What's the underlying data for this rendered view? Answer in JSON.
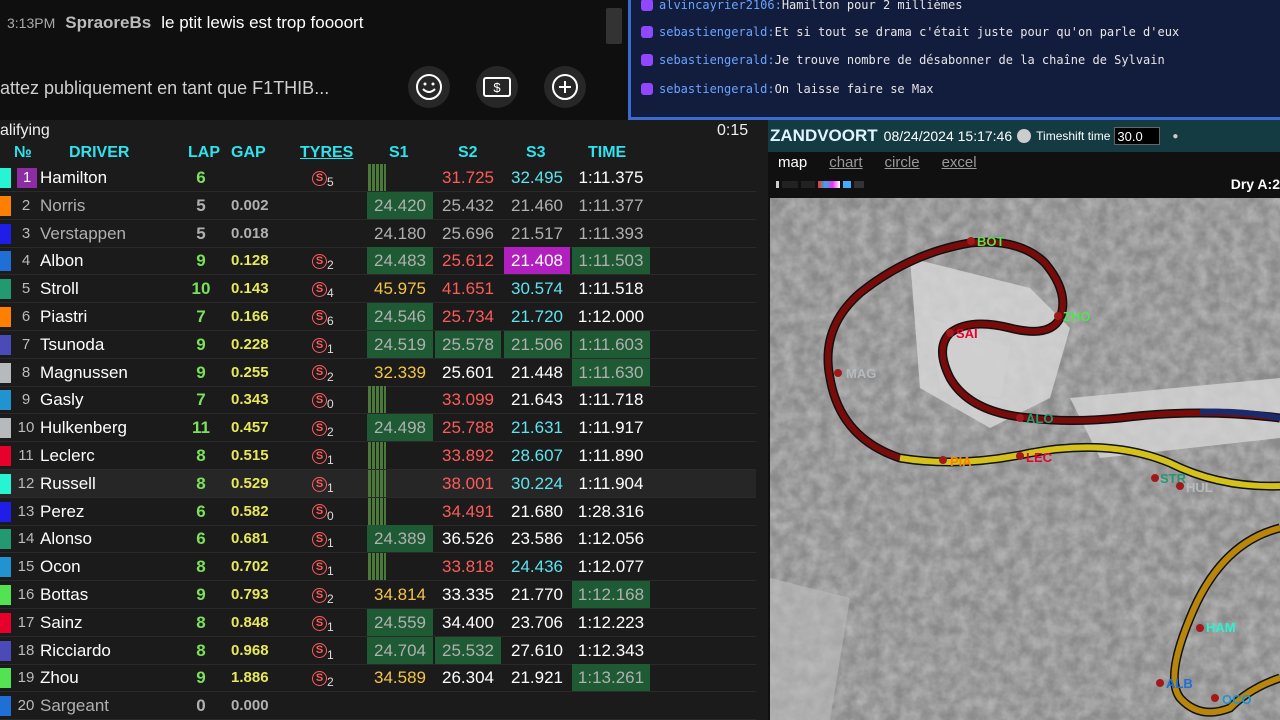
{
  "yt_chat": {
    "time": "3:13PM",
    "user": "SpraoreBs",
    "message": "le ptit lewis est trop foooort",
    "input_placeholder": "attez publiquement en tant que F1THIB..."
  },
  "twitch_chat": {
    "lines": [
      {
        "user": "alvincayrier2106:",
        "message": "Hamilton pour 2 millièmes"
      },
      {
        "user": "sebastiengerald:",
        "message": "Et si tout se drama c'était juste pour qu'on parle d'eux"
      },
      {
        "user": "sebastiengerald:",
        "message": "Je trouve nombre de désabonner de la chaîne de Sylvain"
      },
      {
        "user": "sebastiengerald:",
        "message": "On laisse faire se Max"
      }
    ]
  },
  "timing": {
    "session": "alifying",
    "clock": "0:15",
    "headers": {
      "pos": "№",
      "driver": "DRIVER",
      "lap": "LAP",
      "gap": "GAP",
      "tyres": "TYRES",
      "s1": "S1",
      "s2": "S2",
      "s3": "S3",
      "time": "TIME"
    },
    "rows": [
      {
        "pos": "1",
        "driver": "Hamilton",
        "lap": "6",
        "gap": "",
        "tyre": "S",
        "tyre_age": "5",
        "s1": "",
        "s2": "31.725",
        "s3": "32.495",
        "time": "1:11.375",
        "team_color": "#27f4d2"
      },
      {
        "pos": "2",
        "driver": "Norris",
        "lap": "5",
        "gap": "0.002",
        "tyre": "",
        "tyre_age": "",
        "s1": "24.420",
        "s2": "25.432",
        "s3": "21.460",
        "time": "1:11.377",
        "team_color": "#ff8000"
      },
      {
        "pos": "3",
        "driver": "Verstappen",
        "lap": "5",
        "gap": "0.018",
        "tyre": "",
        "tyre_age": "",
        "s1": "24.180",
        "s2": "25.696",
        "s3": "21.517",
        "time": "1:11.393",
        "team_color": "#1e1ee8"
      },
      {
        "pos": "4",
        "driver": "Albon",
        "lap": "9",
        "gap": "0.128",
        "tyre": "S",
        "tyre_age": "2",
        "s1": "24.483",
        "s2": "25.612",
        "s3": "21.408",
        "time": "1:11.503",
        "team_color": "#1e6fd6"
      },
      {
        "pos": "5",
        "driver": "Stroll",
        "lap": "10",
        "gap": "0.143",
        "tyre": "S",
        "tyre_age": "4",
        "s1": "45.975",
        "s2": "41.651",
        "s3": "30.574",
        "time": "1:11.518",
        "team_color": "#229971"
      },
      {
        "pos": "6",
        "driver": "Piastri",
        "lap": "7",
        "gap": "0.166",
        "tyre": "S",
        "tyre_age": "6",
        "s1": "24.546",
        "s2": "25.734",
        "s3": "21.720",
        "time": "1:12.000",
        "team_color": "#ff8000"
      },
      {
        "pos": "7",
        "driver": "Tsunoda",
        "lap": "9",
        "gap": "0.228",
        "tyre": "S",
        "tyre_age": "1",
        "s1": "24.519",
        "s2": "25.578",
        "s3": "21.506",
        "time": "1:11.603",
        "team_color": "#4a4ab8"
      },
      {
        "pos": "8",
        "driver": "Magnussen",
        "lap": "9",
        "gap": "0.255",
        "tyre": "S",
        "tyre_age": "2",
        "s1": "32.339",
        "s2": "25.601",
        "s3": "21.448",
        "time": "1:11.630",
        "team_color": "#b6babd"
      },
      {
        "pos": "9",
        "driver": "Gasly",
        "lap": "7",
        "gap": "0.343",
        "tyre": "S",
        "tyre_age": "0",
        "s1": "",
        "s2": "33.099",
        "s3": "21.643",
        "time": "1:11.718",
        "team_color": "#2293d1"
      },
      {
        "pos": "10",
        "driver": "Hulkenberg",
        "lap": "11",
        "gap": "0.457",
        "tyre": "S",
        "tyre_age": "2",
        "s1": "24.498",
        "s2": "25.788",
        "s3": "21.631",
        "time": "1:11.917",
        "team_color": "#b6babd"
      },
      {
        "pos": "11",
        "driver": "Leclerc",
        "lap": "8",
        "gap": "0.515",
        "tyre": "S",
        "tyre_age": "1",
        "s1": "",
        "s2": "33.892",
        "s3": "28.607",
        "time": "1:11.890",
        "team_color": "#e8002d"
      },
      {
        "pos": "12",
        "driver": "Russell",
        "lap": "8",
        "gap": "0.529",
        "tyre": "S",
        "tyre_age": "1",
        "s1": "",
        "s2": "38.001",
        "s3": "30.224",
        "time": "1:11.904",
        "team_color": "#27f4d2"
      },
      {
        "pos": "13",
        "driver": "Perez",
        "lap": "6",
        "gap": "0.582",
        "tyre": "S",
        "tyre_age": "0",
        "s1": "",
        "s2": "34.491",
        "s3": "21.680",
        "time": "1:28.316",
        "team_color": "#1e1ee8"
      },
      {
        "pos": "14",
        "driver": "Alonso",
        "lap": "6",
        "gap": "0.681",
        "tyre": "S",
        "tyre_age": "1",
        "s1": "24.389",
        "s2": "36.526",
        "s3": "23.586",
        "time": "1:12.056",
        "team_color": "#229971"
      },
      {
        "pos": "15",
        "driver": "Ocon",
        "lap": "8",
        "gap": "0.702",
        "tyre": "S",
        "tyre_age": "1",
        "s1": "",
        "s2": "33.818",
        "s3": "24.436",
        "time": "1:12.077",
        "team_color": "#2293d1"
      },
      {
        "pos": "16",
        "driver": "Bottas",
        "lap": "9",
        "gap": "0.793",
        "tyre": "S",
        "tyre_age": "2",
        "s1": "34.814",
        "s2": "33.335",
        "s3": "21.770",
        "time": "1:12.168",
        "team_color": "#52e252"
      },
      {
        "pos": "17",
        "driver": "Sainz",
        "lap": "8",
        "gap": "0.848",
        "tyre": "S",
        "tyre_age": "1",
        "s1": "24.559",
        "s2": "34.400",
        "s3": "23.706",
        "time": "1:12.223",
        "team_color": "#e8002d"
      },
      {
        "pos": "18",
        "driver": "Ricciardo",
        "lap": "8",
        "gap": "0.968",
        "tyre": "S",
        "tyre_age": "1",
        "s1": "24.704",
        "s2": "25.532",
        "s3": "27.610",
        "time": "1:12.343",
        "team_color": "#4a4ab8"
      },
      {
        "pos": "19",
        "driver": "Zhou",
        "lap": "9",
        "gap": "1.886",
        "tyre": "S",
        "tyre_age": "2",
        "s1": "34.589",
        "s2": "26.304",
        "s3": "21.921",
        "time": "1:13.261",
        "team_color": "#52e252"
      },
      {
        "pos": "20",
        "driver": "Sargeant",
        "lap": "0",
        "gap": "0.000",
        "tyre": "",
        "tyre_age": "",
        "s1": "",
        "s2": "",
        "s3": "",
        "time": "",
        "team_color": "#1e6fd6"
      }
    ]
  },
  "map_panel": {
    "circuit": "ZANDVOORT",
    "datetime": "08/24/2024 15:17:46",
    "timeshift_label": "Timeshift time",
    "timeshift_value": "30.0",
    "tabs": [
      "map",
      "chart",
      "circle",
      "excel"
    ],
    "active_tab": "map",
    "weather": "Dry A:2",
    "driver_labels": [
      "BOT",
      "ZHO",
      "SAI",
      "MAG",
      "ALO",
      "PIA",
      "LEC",
      "STR",
      "HUL",
      "HAM",
      "ALB",
      "OCO"
    ]
  }
}
